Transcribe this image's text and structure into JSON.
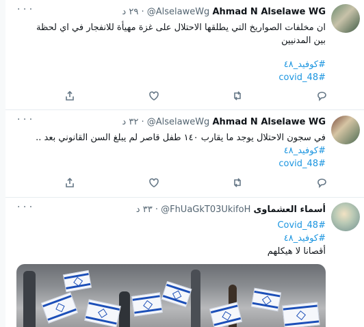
{
  "tweets": [
    {
      "name": "Ahmad N Alselawe WG",
      "handle": "@AlselaweWg",
      "time": "٢٩ د",
      "text_lines": [
        "ان مخلفات الصواريخ التي يطلقها الاحتلال على غزة مهيأة للانفجار في اي لحظة",
        "بين المدنيين"
      ],
      "hashtags": [
        "#كوفيد_٤٨",
        "#covid_48"
      ]
    },
    {
      "name": "Ahmad N Alselawe WG",
      "handle": "@AlselaweWg",
      "time": "٣٢ د",
      "text_lines": [
        "في سجون الاحتلال يوجد ما يقارب ١٤٠ طفل قاصر لم يبلغ السن القانوني بعد .."
      ],
      "hashtags": [
        "#كوفيد_٤٨",
        "#covid_48"
      ]
    },
    {
      "name": "أسماء العشماوى",
      "handle": "@FhUaGkT03UkifoH",
      "time": "٣٣ د",
      "hashtags": [
        "#Covid_48",
        "#كوفيد_٤٨"
      ],
      "text_lines": [
        "أقصانا لا هيكلهم"
      ]
    }
  ],
  "icons": {
    "share": "share-icon",
    "like": "heart-icon",
    "retweet": "retweet-icon",
    "reply": "reply-icon",
    "more": "more-dots-icon"
  },
  "more_label": "· · ·",
  "colors": {
    "accent": "#1b95e0",
    "muted": "#536471",
    "text": "#0f1419",
    "divider": "#e6ecf0"
  }
}
